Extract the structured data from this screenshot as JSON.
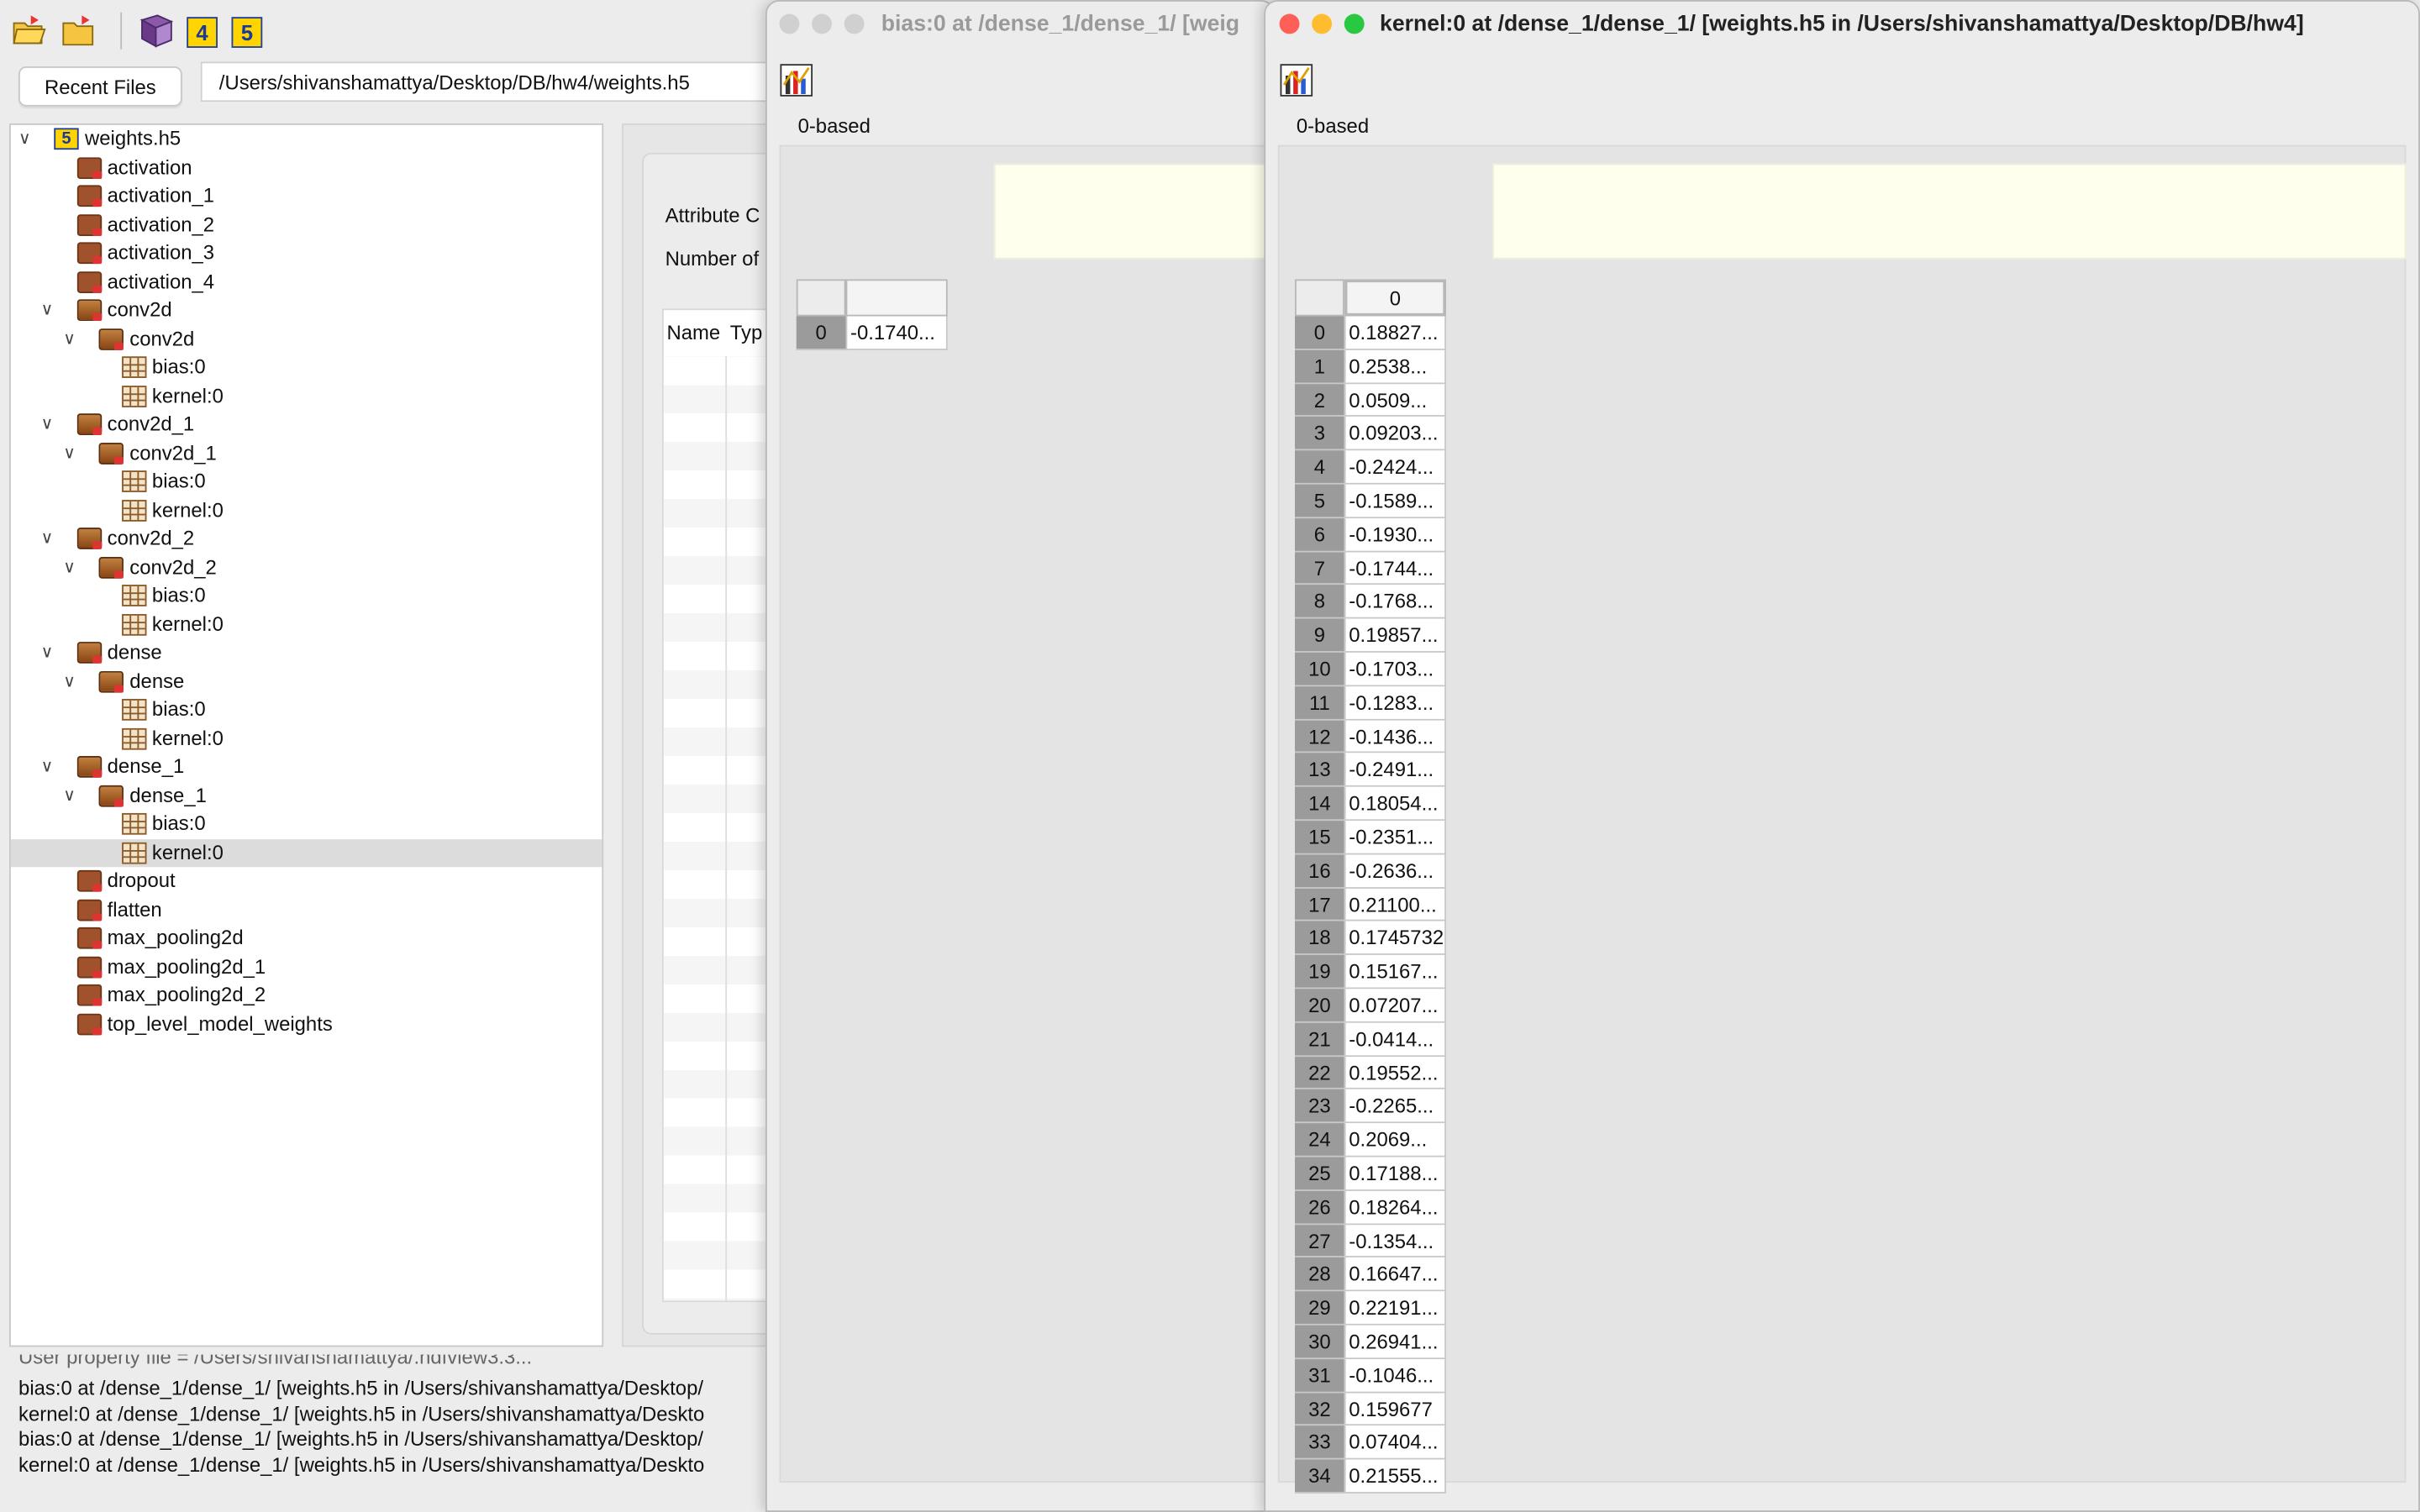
{
  "main": {
    "toolbar": {
      "icons": [
        "open-file-icon",
        "open-folder-icon",
        "help-book-icon",
        "hdf4-icon",
        "hdf5-icon"
      ],
      "hdf4_label": "4",
      "hdf5_label": "5"
    },
    "recent_files_label": "Recent Files",
    "file_path": "/Users/shivanshamattya/Desktop/DB/hw4/weights.h5",
    "tree": [
      {
        "label": "weights.h5",
        "level": 0,
        "icon": "hdf5-file-icon",
        "expanded": true
      },
      {
        "label": "activation",
        "level": 1,
        "icon": "folder-icon"
      },
      {
        "label": "activation_1",
        "level": 1,
        "icon": "folder-icon"
      },
      {
        "label": "activation_2",
        "level": 1,
        "icon": "folder-icon"
      },
      {
        "label": "activation_3",
        "level": 1,
        "icon": "folder-icon"
      },
      {
        "label": "activation_4",
        "level": 1,
        "icon": "folder-icon"
      },
      {
        "label": "conv2d",
        "level": 1,
        "icon": "folder-open-icon",
        "expanded": true
      },
      {
        "label": "conv2d",
        "level": 2,
        "icon": "folder-open-icon",
        "expanded": true
      },
      {
        "label": "bias:0",
        "level": 3,
        "icon": "dataset-icon"
      },
      {
        "label": "kernel:0",
        "level": 3,
        "icon": "dataset-icon"
      },
      {
        "label": "conv2d_1",
        "level": 1,
        "icon": "folder-open-icon",
        "expanded": true
      },
      {
        "label": "conv2d_1",
        "level": 2,
        "icon": "folder-open-icon",
        "expanded": true
      },
      {
        "label": "bias:0",
        "level": 3,
        "icon": "dataset-icon"
      },
      {
        "label": "kernel:0",
        "level": 3,
        "icon": "dataset-icon"
      },
      {
        "label": "conv2d_2",
        "level": 1,
        "icon": "folder-open-icon",
        "expanded": true
      },
      {
        "label": "conv2d_2",
        "level": 2,
        "icon": "folder-open-icon",
        "expanded": true
      },
      {
        "label": "bias:0",
        "level": 3,
        "icon": "dataset-icon"
      },
      {
        "label": "kernel:0",
        "level": 3,
        "icon": "dataset-icon"
      },
      {
        "label": "dense",
        "level": 1,
        "icon": "folder-open-icon",
        "expanded": true
      },
      {
        "label": "dense",
        "level": 2,
        "icon": "folder-open-icon",
        "expanded": true
      },
      {
        "label": "bias:0",
        "level": 3,
        "icon": "dataset-icon"
      },
      {
        "label": "kernel:0",
        "level": 3,
        "icon": "dataset-icon"
      },
      {
        "label": "dense_1",
        "level": 1,
        "icon": "folder-open-icon",
        "expanded": true
      },
      {
        "label": "dense_1",
        "level": 2,
        "icon": "folder-open-icon",
        "expanded": true
      },
      {
        "label": "bias:0",
        "level": 3,
        "icon": "dataset-icon"
      },
      {
        "label": "kernel:0",
        "level": 3,
        "icon": "dataset-icon",
        "selected": true
      },
      {
        "label": "dropout",
        "level": 1,
        "icon": "folder-icon"
      },
      {
        "label": "flatten",
        "level": 1,
        "icon": "folder-icon"
      },
      {
        "label": "max_pooling2d",
        "level": 1,
        "icon": "folder-icon"
      },
      {
        "label": "max_pooling2d_1",
        "level": 1,
        "icon": "folder-icon"
      },
      {
        "label": "max_pooling2d_2",
        "level": 1,
        "icon": "folder-icon"
      },
      {
        "label": "top_level_model_weights",
        "level": 1,
        "icon": "folder-icon"
      }
    ],
    "attributes": {
      "label_1": "Attribute C",
      "label_2": "Number of",
      "col_name": "Name",
      "col_type": "Typ"
    },
    "log_lines": [
      "User property file = /Users/shivanshamattya/.hdfview3.3...",
      "bias:0  at  /dense_1/dense_1/  [weights.h5  in  /Users/shivanshamattya/Desktop/",
      "kernel:0  at  /dense_1/dense_1/  [weights.h5  in  /Users/shivanshamattya/Deskto",
      "bias:0  at  /dense_1/dense_1/  [weights.h5  in  /Users/shivanshamattya/Desktop/",
      "kernel:0  at  /dense_1/dense_1/  [weights.h5  in  /Users/shivanshamattya/Deskto"
    ]
  },
  "bias_window": {
    "title": "bias:0  at  /dense_1/dense_1/  [weig",
    "index_base": "0-based",
    "column_header": "",
    "rows": [
      {
        "index": "0",
        "value": "-0.1740..."
      }
    ]
  },
  "kernel_window": {
    "title": "kernel:0  at  /dense_1/dense_1/  [weights.h5  in  /Users/shivanshamattya/Desktop/DB/hw4]",
    "index_base": "0-based",
    "column_header": "0",
    "rows": [
      {
        "index": "0",
        "value": "0.18827..."
      },
      {
        "index": "1",
        "value": "0.2538..."
      },
      {
        "index": "2",
        "value": "0.0509..."
      },
      {
        "index": "3",
        "value": "0.09203..."
      },
      {
        "index": "4",
        "value": "-0.2424..."
      },
      {
        "index": "5",
        "value": "-0.1589..."
      },
      {
        "index": "6",
        "value": "-0.1930..."
      },
      {
        "index": "7",
        "value": "-0.1744..."
      },
      {
        "index": "8",
        "value": "-0.1768..."
      },
      {
        "index": "9",
        "value": "0.19857..."
      },
      {
        "index": "10",
        "value": "-0.1703..."
      },
      {
        "index": "11",
        "value": "-0.1283..."
      },
      {
        "index": "12",
        "value": "-0.1436..."
      },
      {
        "index": "13",
        "value": "-0.2491..."
      },
      {
        "index": "14",
        "value": "0.18054..."
      },
      {
        "index": "15",
        "value": "-0.2351..."
      },
      {
        "index": "16",
        "value": "-0.2636..."
      },
      {
        "index": "17",
        "value": "0.21100..."
      },
      {
        "index": "18",
        "value": "0.1745732"
      },
      {
        "index": "19",
        "value": "0.15167..."
      },
      {
        "index": "20",
        "value": "0.07207..."
      },
      {
        "index": "21",
        "value": "-0.0414..."
      },
      {
        "index": "22",
        "value": "0.19552..."
      },
      {
        "index": "23",
        "value": "-0.2265..."
      },
      {
        "index": "24",
        "value": "0.2069..."
      },
      {
        "index": "25",
        "value": "0.17188..."
      },
      {
        "index": "26",
        "value": "0.18264..."
      },
      {
        "index": "27",
        "value": "-0.1354..."
      },
      {
        "index": "28",
        "value": "0.16647..."
      },
      {
        "index": "29",
        "value": "0.22191..."
      },
      {
        "index": "30",
        "value": "0.26941..."
      },
      {
        "index": "31",
        "value": "-0.1046..."
      },
      {
        "index": "32",
        "value": "0.159677"
      },
      {
        "index": "33",
        "value": "0.07404..."
      },
      {
        "index": "34",
        "value": "0.21555..."
      }
    ]
  },
  "colors": {
    "traffic_red": "#ff5f57",
    "traffic_yellow": "#febc2e",
    "traffic_green": "#28c840",
    "inactive_light": "#d0d0d0",
    "note_bg": "#ffffee",
    "selected_row": "#dcdcdc"
  }
}
